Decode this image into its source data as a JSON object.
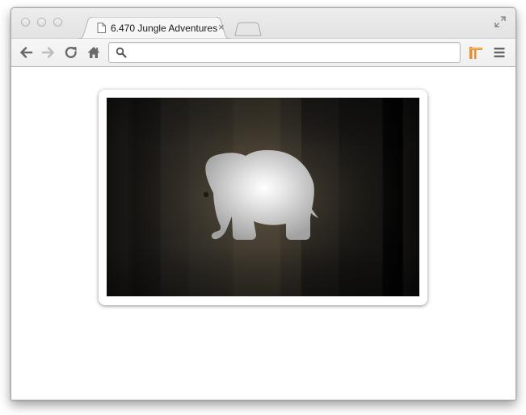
{
  "browser": {
    "tab": {
      "title": "6.470 Jungle Adventures",
      "close_glyph": "×"
    },
    "address_bar": {
      "value": "",
      "placeholder": ""
    },
    "icons": {
      "back": "back-arrow-icon",
      "forward": "forward-arrow-icon",
      "reload": "reload-icon",
      "home": "home-icon",
      "search": "search-icon",
      "extension": "extension-icon",
      "menu": "hamburger-menu-icon",
      "restore": "fullscreen-icon"
    }
  },
  "page": {
    "game": {
      "character": "elephant",
      "colors": {
        "background_dark": "#0e0c0a",
        "light_glow": "#5c5240",
        "elephant_light": "#f4f4f4",
        "elephant_dark": "#9c9c9c",
        "frame": "#ffffff"
      }
    }
  }
}
